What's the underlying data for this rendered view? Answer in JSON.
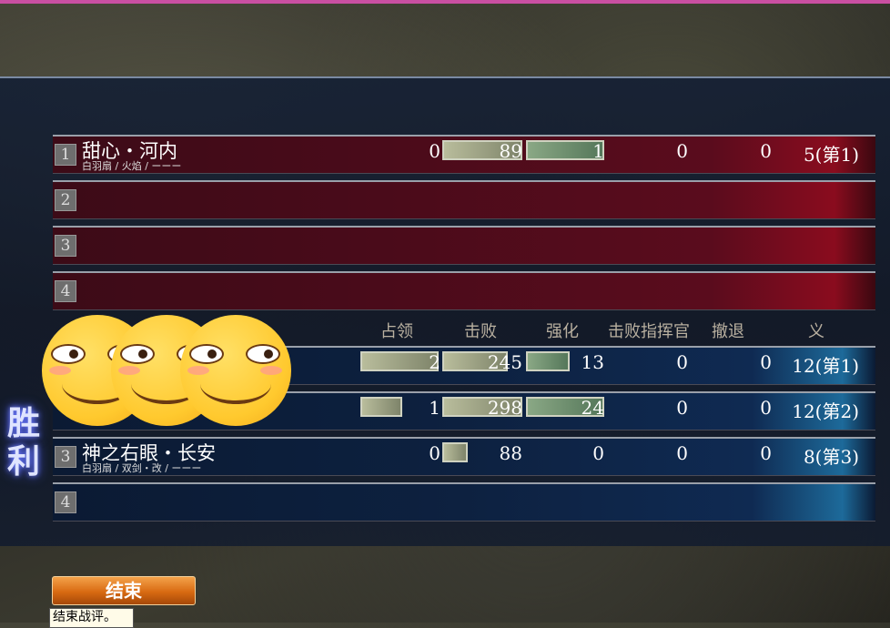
{
  "headers": [
    "占领",
    "击败",
    "强化",
    "击败指挥官",
    "撤退",
    "义"
  ],
  "victory_label": "胜利",
  "red_team": [
    {
      "rank": "1",
      "name": "甜心・河内",
      "sub": "白羽扇 / 火焰 / ーーー",
      "occupy": "0",
      "defeat": "89",
      "enhance": "1",
      "cmd": "0",
      "retreat": "0",
      "honor": "5(第1)"
    },
    {
      "rank": "2"
    },
    {
      "rank": "3"
    },
    {
      "rank": "4"
    }
  ],
  "blue_team": [
    {
      "rank": "1",
      "name": "",
      "sub": "",
      "occupy": "2",
      "defeat": "245",
      "enhance": "13",
      "cmd": "0",
      "retreat": "0",
      "honor": "12(第1)"
    },
    {
      "rank": "2",
      "name": "",
      "sub": "",
      "occupy": "1",
      "defeat": "298",
      "enhance": "24",
      "cmd": "0",
      "retreat": "0",
      "honor": "12(第2)"
    },
    {
      "rank": "3",
      "name": "神之右眼・长安",
      "sub": "白羽扇 / 双剑・改 / ーーー",
      "occupy": "0",
      "defeat": "88",
      "enhance": "0",
      "cmd": "0",
      "retreat": "0",
      "honor": "8(第3)"
    },
    {
      "rank": "4"
    }
  ],
  "end_button": "结束",
  "tooltip": "结束战评。",
  "colors": {
    "top_edge": "#c94fa2",
    "button": "#d86a12",
    "victory_glow": "#6f7dff"
  }
}
